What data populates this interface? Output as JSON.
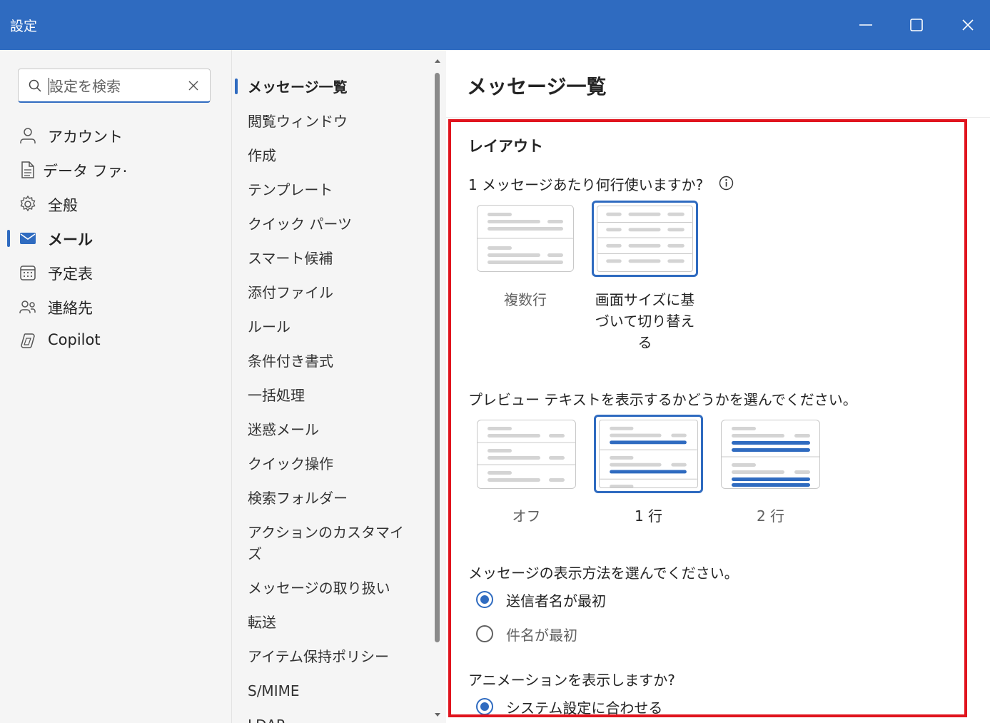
{
  "window": {
    "title": "設定"
  },
  "search": {
    "placeholder": "設定を検索"
  },
  "left_nav": {
    "items": [
      {
        "label": "アカウント",
        "icon": "person-icon"
      },
      {
        "label": "データ ファ·",
        "icon": "document-icon"
      },
      {
        "label": "全般",
        "icon": "gear-icon"
      },
      {
        "label": "メール",
        "icon": "mail-icon",
        "active": true
      },
      {
        "label": "予定表",
        "icon": "calendar-icon"
      },
      {
        "label": "連絡先",
        "icon": "people-icon"
      },
      {
        "label": "Copilot",
        "icon": "copilot-icon"
      }
    ]
  },
  "mail_nav": {
    "items": [
      "メッセージ一覧",
      "閲覧ウィンドウ",
      "作成",
      "テンプレート",
      "クイック パーツ",
      "スマート候補",
      "添付ファイル",
      "ルール",
      "条件付き書式",
      "一括処理",
      "迷惑メール",
      "クイック操作",
      "検索フォルダー",
      "アクションのカスタマイ\nズ",
      "メッセージの取り扱い",
      "転送",
      "アイテム保持ポリシー",
      "S/MIME",
      "LDAP"
    ]
  },
  "content": {
    "title": "メッセージ一覧",
    "layout": {
      "heading": "レイアウト",
      "lines_question": "1 メッセージあたり何行使いますか?",
      "lines_options": [
        "複数行",
        "画面サイズに基\nづいて切り替え\nる"
      ],
      "lines_selected": 1,
      "preview_question": "プレビュー テキストを表示するかどうかを選んでください。",
      "preview_options": [
        "オフ",
        "1 行",
        "2 行"
      ],
      "preview_selected": 1,
      "display_question": "メッセージの表示方法を選んでください。",
      "display_options": [
        "送信者名が最初",
        "件名が最初"
      ],
      "display_selected": 0,
      "animation_question": "アニメーションを表示しますか?",
      "animation_options": [
        "システム設定に合わせる"
      ],
      "animation_selected": 0
    }
  },
  "colors": {
    "accent": "#2f6bc0",
    "highlight_box": "#e0141e"
  }
}
